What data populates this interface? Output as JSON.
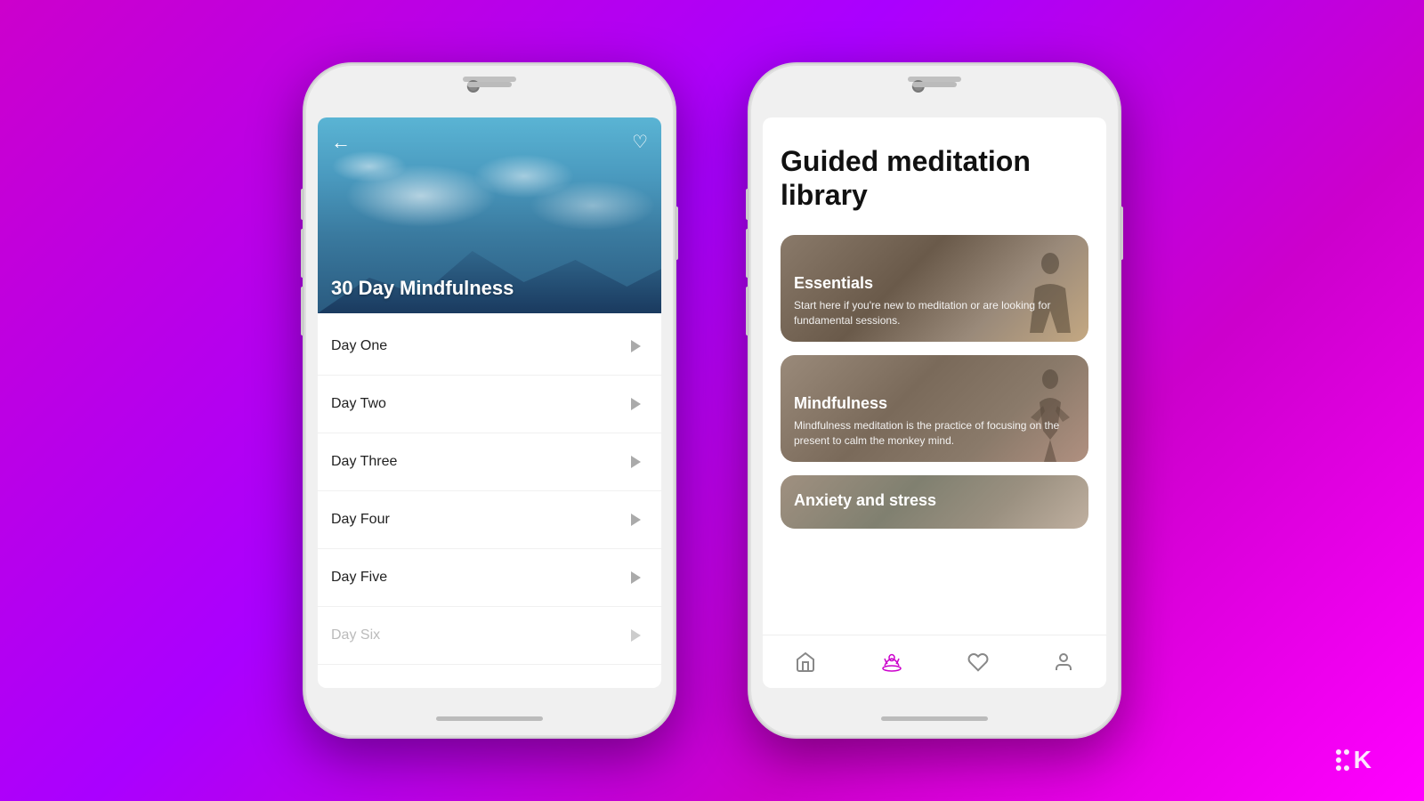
{
  "background": {
    "gradient_start": "#cc00cc",
    "gradient_end": "#ff00ff"
  },
  "phone1": {
    "hero": {
      "title": "30 Day Mindfulness",
      "back_label": "←",
      "heart_label": "♡"
    },
    "days": [
      {
        "label": "Day One",
        "active": true,
        "muted": false
      },
      {
        "label": "Day Two",
        "active": false,
        "muted": false
      },
      {
        "label": "Day Three",
        "active": false,
        "muted": false
      },
      {
        "label": "Day Four",
        "active": false,
        "muted": false
      },
      {
        "label": "Day Five",
        "active": false,
        "muted": false
      },
      {
        "label": "Day Six",
        "active": false,
        "muted": true
      }
    ]
  },
  "phone2": {
    "library_title": "Guided meditation library",
    "categories": [
      {
        "title": "Essentials",
        "description": "Start here if you're new to meditation or are looking for fundamental sessions.",
        "style": "essentials"
      },
      {
        "title": "Mindfulness",
        "description": "Mindfulness meditation is the practice of focusing on the present to calm the monkey mind.",
        "style": "mindfulness"
      },
      {
        "title": "Anxiety and stress",
        "description": "",
        "style": "anxiety"
      }
    ],
    "nav": [
      {
        "icon": "🏠",
        "label": "home",
        "active": false
      },
      {
        "icon": "🪷",
        "label": "meditation",
        "active": true
      },
      {
        "icon": "♡",
        "label": "favorites",
        "active": false
      },
      {
        "icon": "👤",
        "label": "profile",
        "active": false
      }
    ]
  },
  "watermark": {
    "letter": "K"
  }
}
